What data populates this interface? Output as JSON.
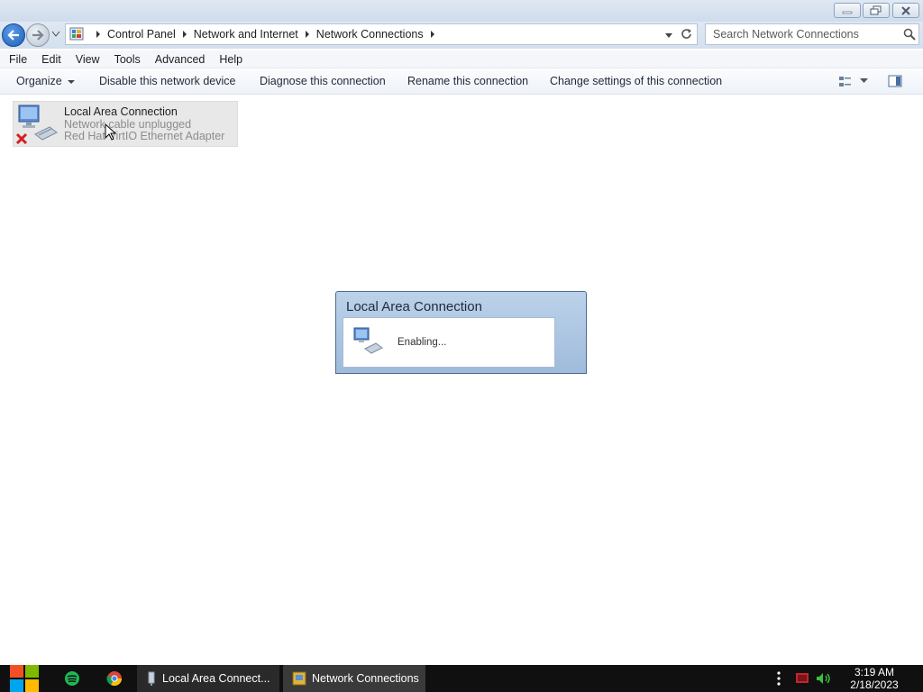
{
  "window": {
    "controls": {
      "minimize_icon": "minimize-icon",
      "restore_icon": "restore-icon",
      "close_icon": "close-icon"
    }
  },
  "address": {
    "breadcrumbs": [
      "Control Panel",
      "Network and Internet",
      "Network Connections"
    ],
    "search_placeholder": "Search Network Connections"
  },
  "menu": {
    "items": [
      "File",
      "Edit",
      "View",
      "Tools",
      "Advanced",
      "Help"
    ]
  },
  "commands": {
    "organize": "Organize",
    "disable": "Disable this network device",
    "diagnose": "Diagnose this connection",
    "rename": "Rename this connection",
    "change_settings": "Change settings of this connection"
  },
  "connection": {
    "name": "Local Area Connection",
    "status": "Network cable unplugged",
    "adapter": "Red Hat VirtIO Ethernet Adapter"
  },
  "dialog": {
    "title": "Local Area Connection",
    "message": "Enabling..."
  },
  "taskbar": {
    "tasks": [
      "Local Area Connect...",
      "Network Connections"
    ],
    "time": "3:19 AM",
    "date": "2/18/2023"
  },
  "colors": {
    "accent": "#1d5fb8",
    "taskbar": "#101010",
    "error_red": "#d22020"
  }
}
